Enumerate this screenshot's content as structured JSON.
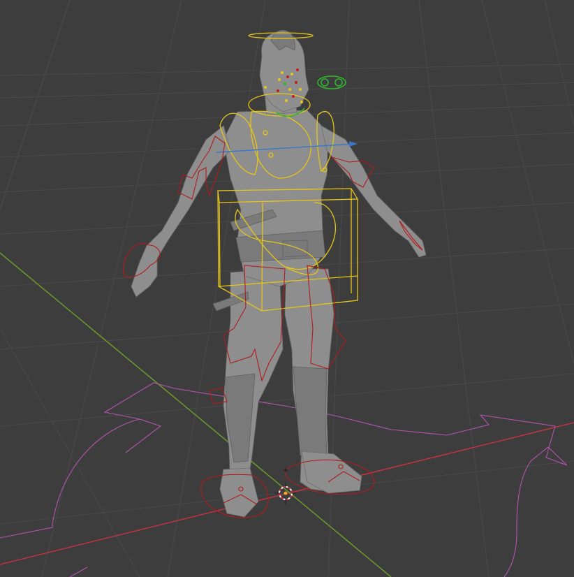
{
  "viewport": {
    "editor": "3D Viewport",
    "mode": "Pose",
    "background": "#3d3d3d",
    "grid_color": "#4a4a4a",
    "x_axis_color": "#c0353f",
    "y_axis_color": "#6e9a2c",
    "bone_color": "#e6c619",
    "deform_control_color": "#b01c1c",
    "ik_control_color": "#2fb52f",
    "root_control_color": "#b255b2",
    "model_color": "#8e8e8e"
  },
  "scene": {
    "objects": [
      "grid-floor",
      "character-mesh",
      "armature-rig",
      "3d-cursor",
      "origin-point"
    ],
    "icons": [
      "3d-cursor-icon",
      "origin-point-icon"
    ]
  }
}
